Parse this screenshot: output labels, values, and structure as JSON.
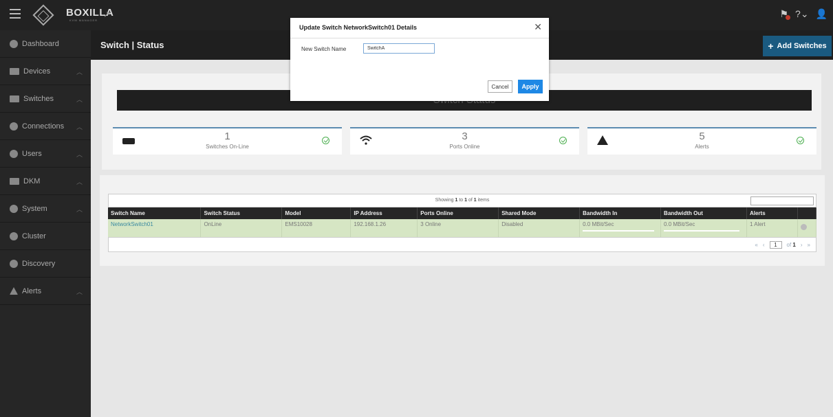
{
  "app": {
    "brand": "BOXILLA",
    "brand_sub": "KVM MANAGER"
  },
  "sidebar": {
    "items": [
      {
        "label": "Dashboard",
        "icon": "dashboard-icon"
      },
      {
        "label": "Devices",
        "icon": "device-icon"
      },
      {
        "label": "Switches",
        "icon": "switch-icon"
      },
      {
        "label": "Connections",
        "icon": "wifi-icon"
      },
      {
        "label": "Users",
        "icon": "users-icon"
      },
      {
        "label": "DKM",
        "icon": "dkm-icon"
      },
      {
        "label": "System",
        "icon": "gear-icon"
      },
      {
        "label": "Cluster",
        "icon": "cluster-icon"
      },
      {
        "label": "Discovery",
        "icon": "discovery-icon"
      },
      {
        "label": "Alerts",
        "icon": "alert-icon"
      }
    ]
  },
  "header": {
    "title": "Switch | Status",
    "add_label": "Add Switches"
  },
  "status": {
    "bar_title": "Switch Status",
    "cards": [
      {
        "value": "1",
        "label": "Switches On-Line",
        "icon": "switch-icon"
      },
      {
        "value": "3",
        "label": "Ports Online",
        "icon": "wifi-icon"
      },
      {
        "value": "5",
        "label": "Alerts",
        "icon": "alert-icon"
      }
    ]
  },
  "table": {
    "info_prefix": "Showing ",
    "info_from": "1",
    "info_mid": " to ",
    "info_to": "1",
    "info_of": " of ",
    "info_total": "1",
    "info_suffix": " items",
    "columns": [
      "Switch Name",
      "Switch Status",
      "Model",
      "IP Address",
      "Ports Online",
      "Shared Mode",
      "Bandwidth In",
      "Bandwidth Out",
      "Alerts"
    ],
    "rows": [
      {
        "name": "NetworkSwitch01",
        "status": "OnLine",
        "model": "EMS10028",
        "ip": "192.168.1.26",
        "ports": "3 Online",
        "shared": "Disabled",
        "bw_in": "0.0 MBit/Sec",
        "bw_out": "0.0 MBit/Sec",
        "alerts": "1 Alert"
      }
    ],
    "pager": {
      "page": "1",
      "of_label": "of",
      "total_pages": "1"
    }
  },
  "modal": {
    "title": "Update Switch NetworkSwitch01 Details",
    "field_label": "New Switch Name",
    "field_value": "SwitchA",
    "cancel_label": "Cancel",
    "apply_label": "Apply"
  },
  "colors": {
    "accent": "#1a5a80",
    "apply": "#1e88e5",
    "row_bg": "#d6e6c4",
    "ok": "#4caf50"
  }
}
